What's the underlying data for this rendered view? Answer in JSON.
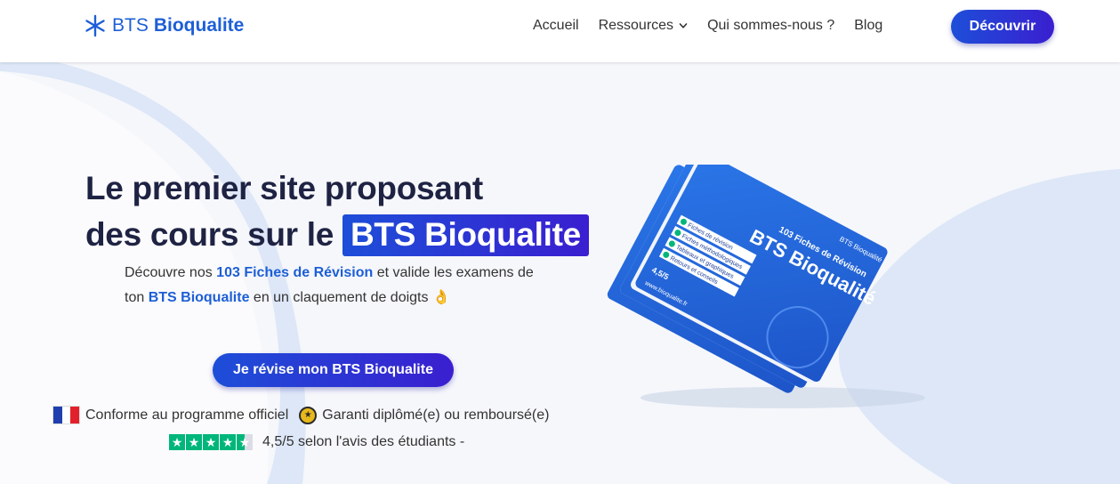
{
  "header": {
    "logo_text_light": "BTS",
    "logo_text_bold": "Bioqualite",
    "nav": [
      {
        "label": "Accueil",
        "has_dropdown": false
      },
      {
        "label": "Ressources",
        "has_dropdown": true
      },
      {
        "label": "Qui sommes-nous ?",
        "has_dropdown": false
      },
      {
        "label": "Blog",
        "has_dropdown": false
      }
    ],
    "cta_label": "Découvrir"
  },
  "hero": {
    "headline_line1": "Le premier site proposant",
    "headline_line2_prefix": "des cours sur le",
    "headline_highlight": "BTS Bioqualite",
    "desc_part1": "Découvre nos ",
    "desc_highlight1": "103 Fiches de Révision",
    "desc_part2": " et valide les examens de ton ",
    "desc_highlight2": "BTS Bioqualite",
    "desc_part3": " en un claquement de doigts",
    "desc_emoji": "👌",
    "cta_label": "Je révise mon BTS Bioqualite"
  },
  "guarantees": {
    "item1": "Conforme au programme officiel",
    "item2": "Garanti diplômé(e) ou remboursé(e)",
    "rating_value": 4.5,
    "rating_max": 5,
    "rating_text": "4,5/5 selon l'avis des étudiants -"
  },
  "book": {
    "brand": "BTS Bioqualité",
    "subtitle": "103 Fiches de Révision",
    "checklist": [
      "Fiches de révision",
      "Fiches méthodologiques",
      "Tableaux et graphiques",
      "Retours et conseils"
    ],
    "rating_badge": "4,5/5",
    "url": "www.bioqualite.fr"
  },
  "colors": {
    "brand_blue": "#1d5fd6",
    "button_gradient_start": "#1d4ed8",
    "button_gradient_end": "#3a1fd0",
    "heading": "#1f2343",
    "trustpilot_green": "#00b67a"
  },
  "icons": {
    "logo": "asterisk-icon",
    "chevron": "chevron-down-icon",
    "flag": "flag-france-icon",
    "medal": "medal-icon",
    "star": "star-icon"
  }
}
